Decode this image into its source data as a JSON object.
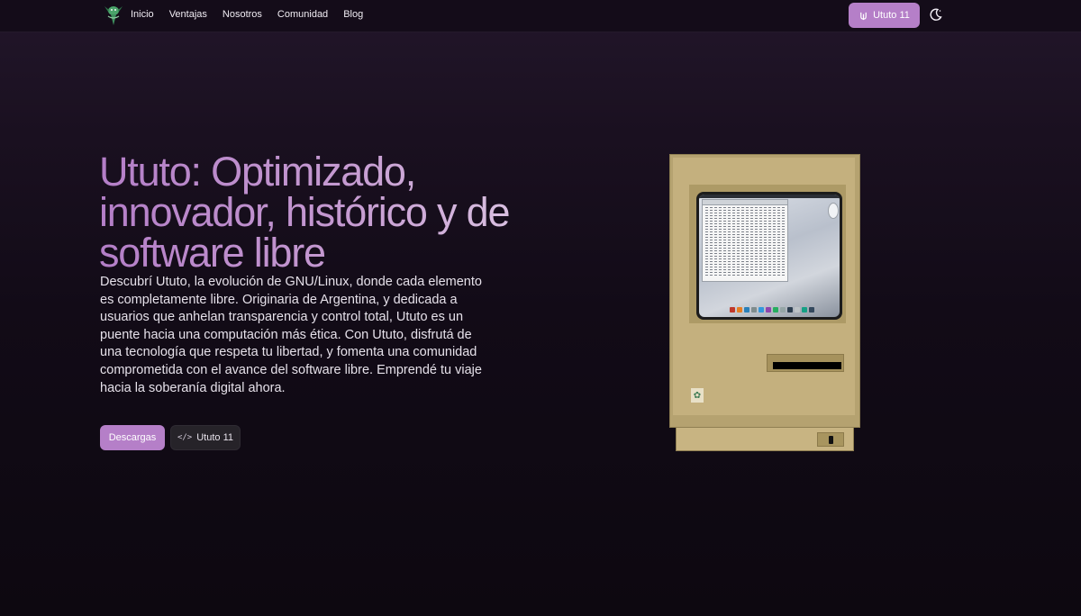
{
  "nav": {
    "links": [
      "Inicio",
      "Ventajas",
      "Nosotros",
      "Comunidad",
      "Blog"
    ],
    "cta_label": "Ututo 11",
    "logo_icon": "ututo-gnu-logo-icon",
    "theme_icon": "moon-icon"
  },
  "hero": {
    "title": "Ututo: Optimizado, innovador, histórico y de software libre",
    "description": "Descubrí Ututo, la evolución de GNU/Linux, donde cada elemento es completamente libre. Originaria de Argentina, y dedicada a usuarios que anhelan transparencia y control total, Ututo es un puente hacia una computación más ética. Con Ututo, disfrutá de una tecnología que respeta tu libertad, y fomenta una comunidad comprometida con el avance del software libre. Emprendé tu viaje hacia la soberanía digital ahora.",
    "primary_button": "Descargas",
    "secondary_button": "Ututo 11",
    "secondary_icon": "code-icon"
  },
  "colors": {
    "accent": "#b57fc8",
    "background": "#120b17",
    "mac_beige": "#c4b07e"
  }
}
